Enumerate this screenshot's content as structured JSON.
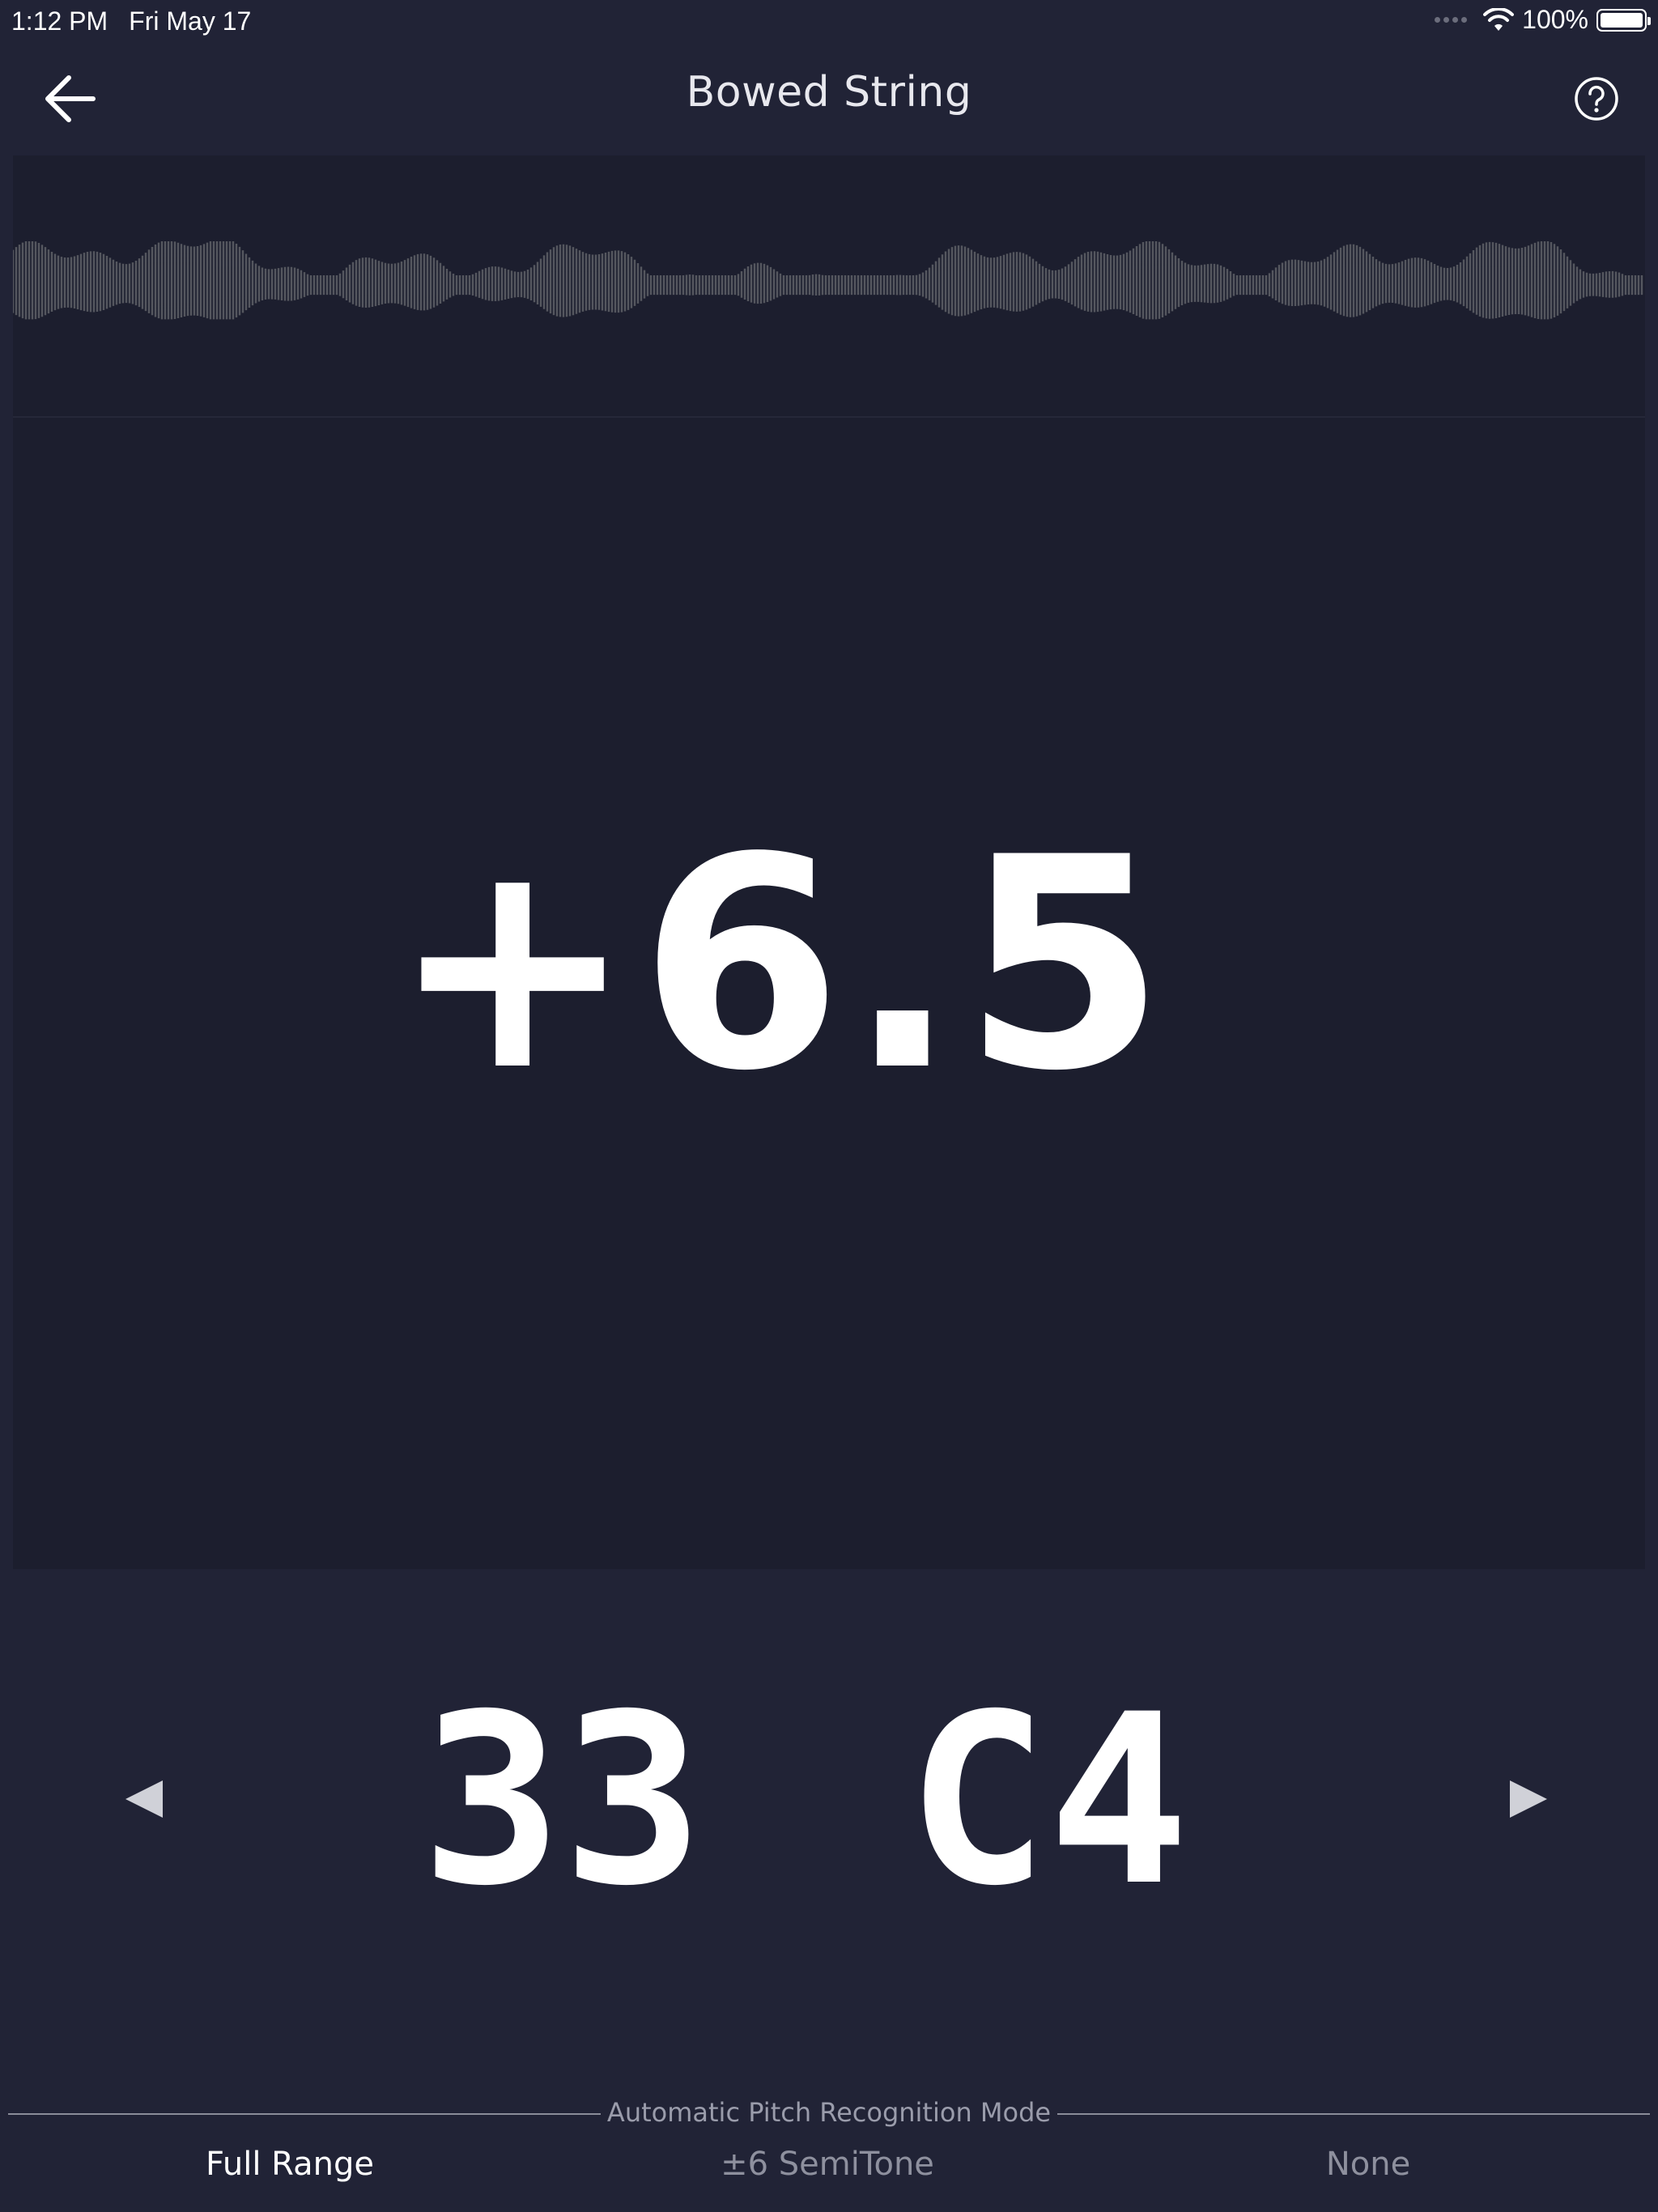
{
  "status_bar": {
    "time": "1:12 PM",
    "date": "Fri May 17",
    "battery_text": "100%",
    "battery_level": 1.0,
    "wifi_icon": "wifi-icon",
    "battery_icon": "battery-icon"
  },
  "header": {
    "title": "Bowed String",
    "back_icon": "arrow-left-icon",
    "help_icon": "question-circle-icon"
  },
  "tuner": {
    "cents_offset": "+6.5",
    "note_number": "33",
    "note_name": "C4",
    "prev_icon": "triangle-left-icon",
    "next_icon": "triangle-right-icon"
  },
  "mode": {
    "label": "Automatic Pitch Recognition Mode",
    "options": [
      {
        "label": "Full Range",
        "selected": true
      },
      {
        "label": "±6 SemiTone",
        "selected": false
      },
      {
        "label": "None",
        "selected": false
      }
    ]
  },
  "colors": {
    "background": "#212336",
    "panel": "#1c1e2e",
    "waveform": "#55575f",
    "text_primary": "#ffffff",
    "text_muted": "#8e909e"
  }
}
